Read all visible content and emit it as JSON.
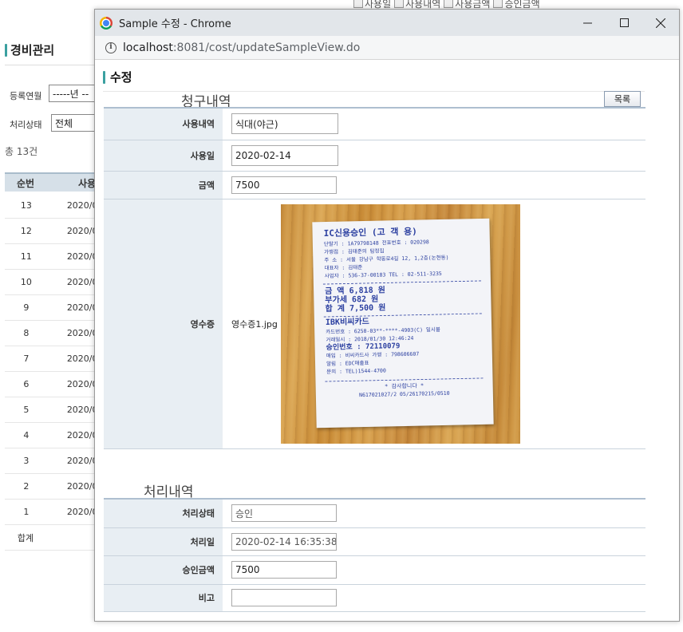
{
  "background": {
    "top_checks": [
      "사용일",
      "사용내역",
      "사용금액",
      "승인금액"
    ],
    "title": "경비관리",
    "filter_label_1": "등록연월",
    "filter_value_1": "-----년 --",
    "filter_label_2": "처리상태",
    "filter_value_2": "전체",
    "total": "총 13건",
    "col_seq": "순번",
    "col_date": "사용",
    "rows": [
      {
        "seq": "13",
        "date": "2020/0"
      },
      {
        "seq": "12",
        "date": "2020/0"
      },
      {
        "seq": "11",
        "date": "2020/0"
      },
      {
        "seq": "10",
        "date": "2020/0"
      },
      {
        "seq": "9",
        "date": "2020/0"
      },
      {
        "seq": "8",
        "date": "2020/0"
      },
      {
        "seq": "7",
        "date": "2020/0"
      },
      {
        "seq": "6",
        "date": "2020/0"
      },
      {
        "seq": "5",
        "date": "2020/0"
      },
      {
        "seq": "4",
        "date": "2020/0"
      },
      {
        "seq": "3",
        "date": "2020/0"
      },
      {
        "seq": "2",
        "date": "2020/0"
      },
      {
        "seq": "1",
        "date": "2020/0"
      }
    ],
    "sum_label": "합계"
  },
  "window": {
    "title": "Sample 수정 - Chrome",
    "url_host": "localhost",
    "url_rest": ":8081/cost/updateSampleView.do"
  },
  "page": {
    "title": "수정",
    "claim_heading": "청구내역",
    "list_button": "목록",
    "claim": {
      "usage_label": "사용내역",
      "usage_value": "식대(야근)",
      "date_label": "사용일",
      "date_value": "2020-02-14",
      "amount_label": "금액",
      "amount_value": "7500",
      "receipt_label": "영수증",
      "receipt_file": "영수증1.jpg"
    },
    "process_heading": "처리내역",
    "process": {
      "status_label": "처리상태",
      "status_value": "승인",
      "processed_label": "처리일",
      "processed_value": "2020-02-14 16:35:38.0",
      "approved_label": "승인금액",
      "approved_value": "7500",
      "note_label": "비고",
      "note_value": ""
    }
  },
  "receipt_image": {
    "lines": [
      "IC신용승인     (고 객 용)",
      "단말기 : 1A79798148     전표번호 : 020298",
      "가맹점 : 김태준의 탐정집",
      "주  소 : 서울 강남구 학동로4길 12, 1,2층(논현동)",
      "대표자 : 김태준",
      "사업자 : 536-37-00183     TEL : 02-511-3235",
      "금   액        6,818 원",
      "부가세          682 원",
      "합   계        7,500 원",
      "IBK비씨카드",
      "카드번호 : 6250-03**-****-4903(C)     일시불",
      "거래일시 : 2018/01/30 12:46:24",
      "승인번호 : 72110079",
      "매입 : 비씨카드사     가맹 : 798606607",
      "알림 : EDC매출표",
      "문의 : TEL)1544-4700",
      "* 감사합니다 *",
      "N617021027/2 05/26170215/0510"
    ]
  },
  "colors": {
    "accent": "#3aa0a0",
    "label_bg": "#e8eef3",
    "table_header_bg": "#d6e0e8",
    "receipt_ink": "#2b3fa0"
  }
}
